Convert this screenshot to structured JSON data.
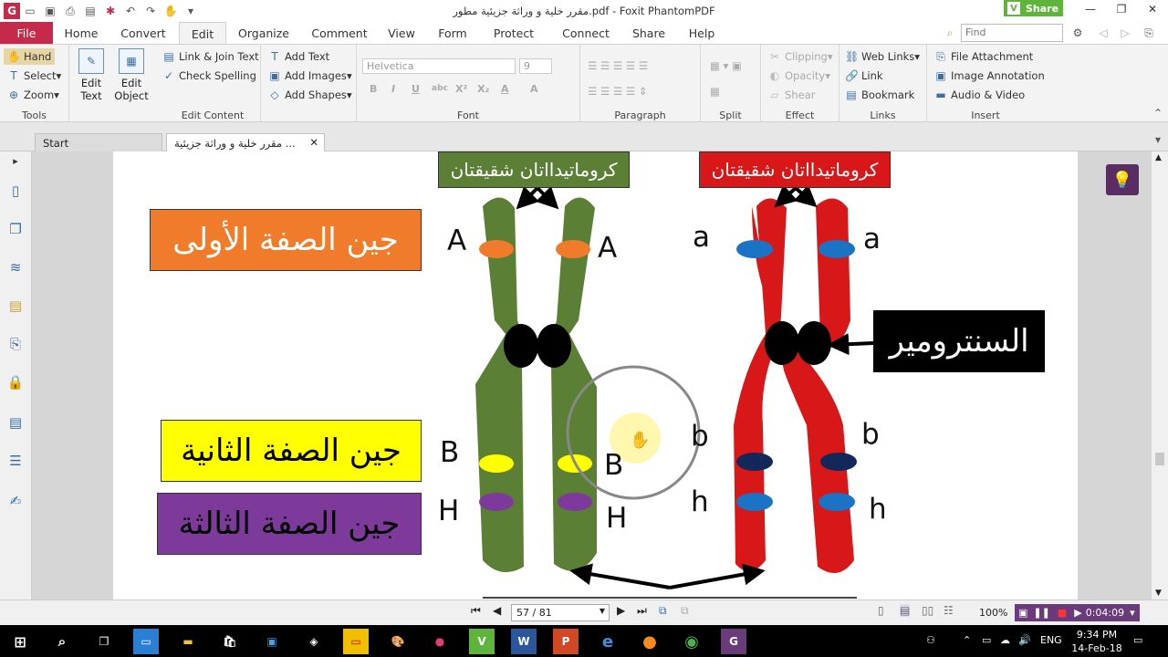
{
  "title_bar": {
    "document_title": "مقرر خلية و وراثة جزيئية مطور.pdf - Foxit PhantomPDF",
    "share_label": "Share",
    "share_badge": "V"
  },
  "menu": {
    "file": "File",
    "tabs": [
      "Home",
      "Convert",
      "Edit",
      "Organize",
      "Comment",
      "View",
      "Form",
      "Protect",
      "Connect",
      "Share",
      "Help"
    ],
    "active_tab": "Edit",
    "find_placeholder": "Find"
  },
  "ribbon": {
    "tools": {
      "label": "Tools",
      "hand": "Hand",
      "select": "Select",
      "zoom": "Zoom"
    },
    "edit_content": {
      "label": "Edit Content",
      "edit_text": "Edit\nText",
      "edit_object": "Edit\nObject",
      "link_join": "Link & Join Text",
      "check_spelling": "Check Spelling",
      "add_text": "Add Text",
      "add_images": "Add Images",
      "add_shapes": "Add Shapes"
    },
    "font": {
      "label": "Font",
      "family": "Helvetica",
      "size": "9",
      "buttons": [
        "B",
        "I",
        "U",
        "abc",
        "X²",
        "X₂",
        "A",
        "A"
      ]
    },
    "paragraph": {
      "label": "Paragraph"
    },
    "split": {
      "label": "Split"
    },
    "effect": {
      "label": "Effect",
      "clipping": "Clipping",
      "opacity": "Opacity",
      "shear": "Shear"
    },
    "links": {
      "label": "Links",
      "web_links": "Web Links",
      "link": "Link",
      "bookmark": "Bookmark"
    },
    "insert": {
      "label": "Insert",
      "file_attachment": "File Attachment",
      "image_annotation": "Image Annotation",
      "audio_video": "Audio & Video"
    }
  },
  "tabs": {
    "start": "Start",
    "document": "مقرر خلية و وراثة جزيئية ..."
  },
  "slide": {
    "green_header": "كروماتيدااتان شقيقتان",
    "red_header": "كروماتيدااتان شقيقتان",
    "centromere": "السنترومير",
    "gene1": "جين الصفة الأولى",
    "gene2": "جين الصفة الثانية",
    "gene3": "جين الصفة الثالثة",
    "green_letters": {
      "A1": "A",
      "A2": "A",
      "B1": "B",
      "B2": "B",
      "H1": "H",
      "H2": "H"
    },
    "red_letters": {
      "a1": "a",
      "a2": "a",
      "b1": "b",
      "b2": "b",
      "h1": "h",
      "h2": "h"
    },
    "colors": {
      "green": "#5c7f36",
      "red": "#d81818",
      "orange": "#f07b2a",
      "yellow": "#ffff00",
      "purple": "#7d3a9a",
      "navy": "#13285a",
      "blue": "#1a73c4"
    }
  },
  "status": {
    "page_indicator": "57 / 81",
    "zoom": "100%",
    "recording_time": "0:04:09"
  },
  "taskbar": {
    "time": "9:34 PM",
    "date": "14-Feb-18",
    "lang": "ENG"
  }
}
